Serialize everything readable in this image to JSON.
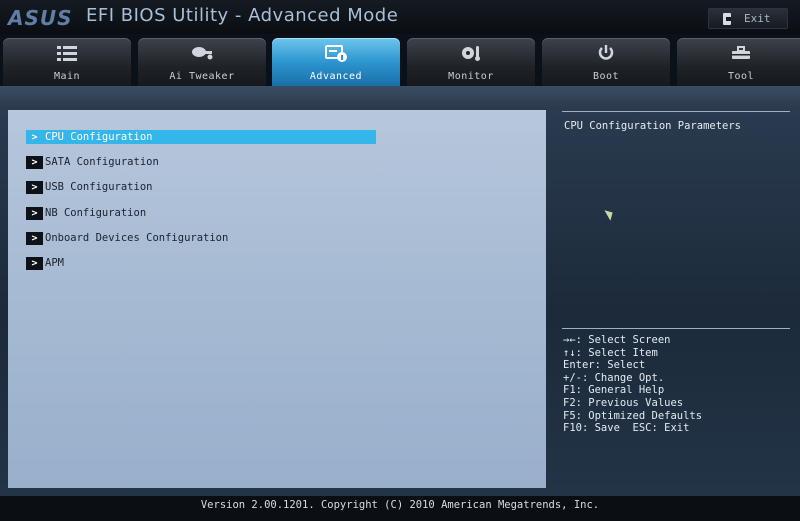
{
  "header": {
    "logo": "ASUS",
    "title": "EFI BIOS Utility - Advanced Mode",
    "exit_label": "Exit"
  },
  "tabs": [
    {
      "label": "Main",
      "icon": "list-icon"
    },
    {
      "label": "Ai Tweaker",
      "icon": "tweaker-icon"
    },
    {
      "label": "Advanced",
      "icon": "advanced-icon",
      "active": true
    },
    {
      "label": "Monitor",
      "icon": "monitor-icon"
    },
    {
      "label": "Boot",
      "icon": "power-icon"
    },
    {
      "label": "Tool",
      "icon": "tool-icon"
    }
  ],
  "menu": {
    "items": [
      {
        "label": "CPU Configuration",
        "selected": true
      },
      {
        "label": "SATA Configuration"
      },
      {
        "label": "USB Configuration"
      },
      {
        "label": "NB Configuration"
      },
      {
        "label": "Onboard Devices Configuration"
      },
      {
        "label": "APM"
      }
    ]
  },
  "help": {
    "description": "CPU Configuration Parameters",
    "keys": [
      "→←: Select Screen",
      "↑↓: Select Item",
      "Enter: Select",
      "+/-: Change Opt.",
      "F1: General Help",
      "F2: Previous Values",
      "F5: Optimized Defaults",
      "F10: Save  ESC: Exit"
    ]
  },
  "footer": {
    "version": "Version 2.00.1201. Copyright (C) 2010 American Megatrends, Inc."
  },
  "colors": {
    "accent": "#35b6ea",
    "panel": "#a8bcd4",
    "background": "#0b1119"
  }
}
